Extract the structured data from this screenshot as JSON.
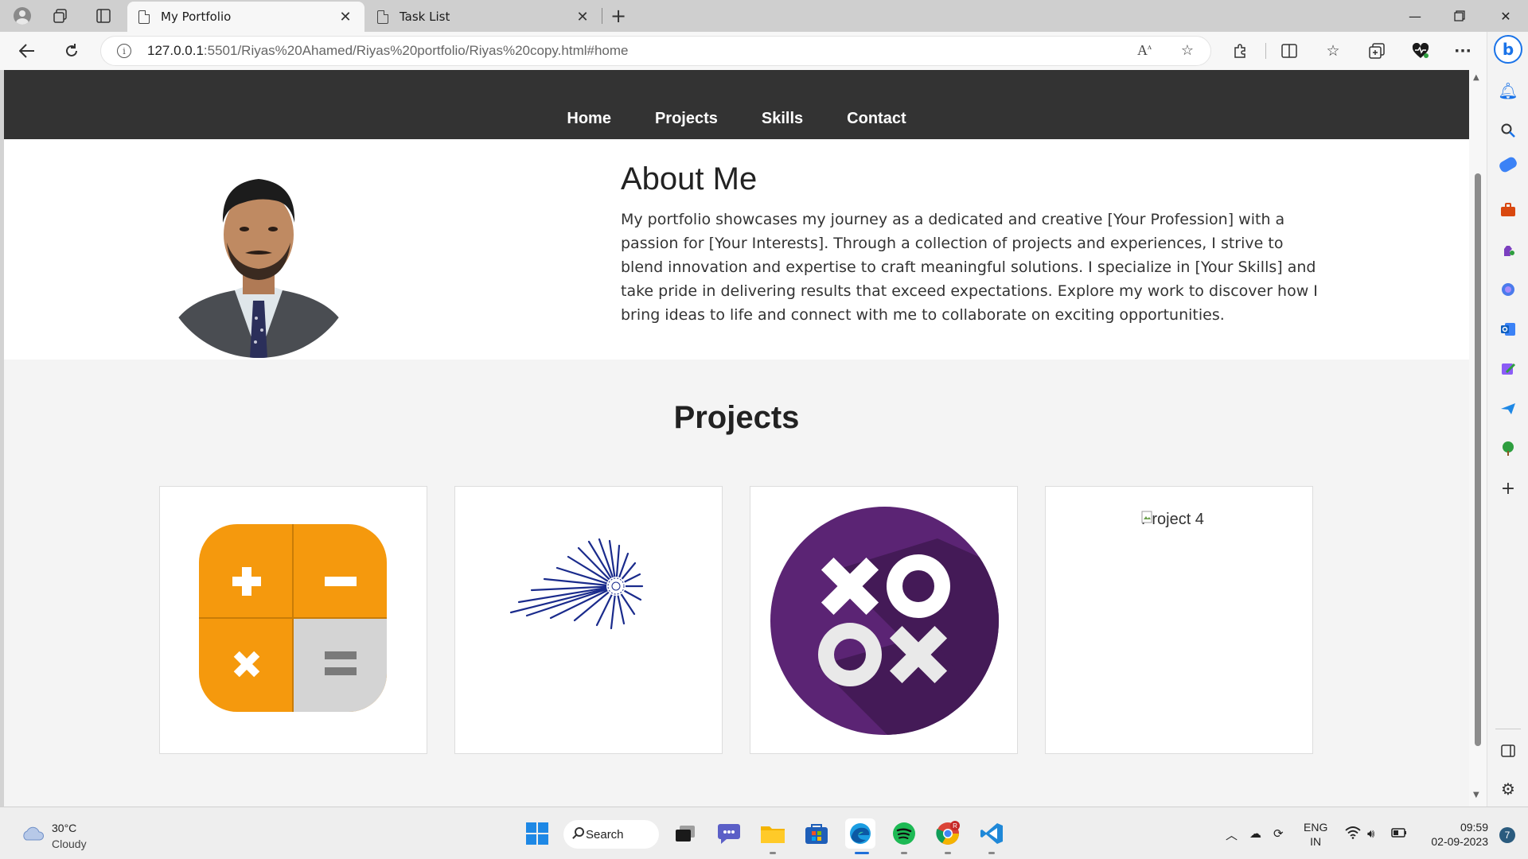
{
  "browser": {
    "tabs": [
      {
        "title": "My Portfolio",
        "active": true
      },
      {
        "title": "Task List",
        "active": false
      }
    ],
    "url_host": "127.0.0.1",
    "url_rest": ":5501/Riyas%20Ahamed/Riyas%20portfolio/Riyas%20copy.html#home",
    "read_aloud_label": "A̅"
  },
  "site": {
    "nav": [
      "Home",
      "Projects",
      "Skills",
      "Contact"
    ],
    "about": {
      "title": "About Me",
      "text": "My portfolio showcases my journey as a dedicated and creative [Your Profession] with a passion for [Your Interests]. Through a collection of projects and experiences, I strive to blend innovation and expertise to craft meaningful solutions. I specialize in [Your Skills] and take pride in delivering results that exceed expectations. Explore my work to discover how I bring ideas to life and connect with me to collaborate on exciting opportunities."
    },
    "projects": {
      "title": "Projects",
      "items": [
        {
          "name": "calculator-icon"
        },
        {
          "name": "spiral-logo"
        },
        {
          "name": "tic-tac-toe-icon"
        },
        {
          "alt": "Project 4"
        }
      ]
    }
  },
  "taskbar": {
    "weather_temp": "30°C",
    "weather_desc": "Cloudy",
    "search_label": "Search",
    "lang_top": "ENG",
    "lang_bottom": "IN",
    "time": "09:59",
    "date": "02-09-2023",
    "notifications": "7",
    "chrome_badge": "R"
  },
  "colors": {
    "site_nav_bg": "#333333",
    "calc_orange": "#f5990d",
    "ttt_purple": "#5b2474",
    "spiral_blue": "#1a2b8c"
  }
}
